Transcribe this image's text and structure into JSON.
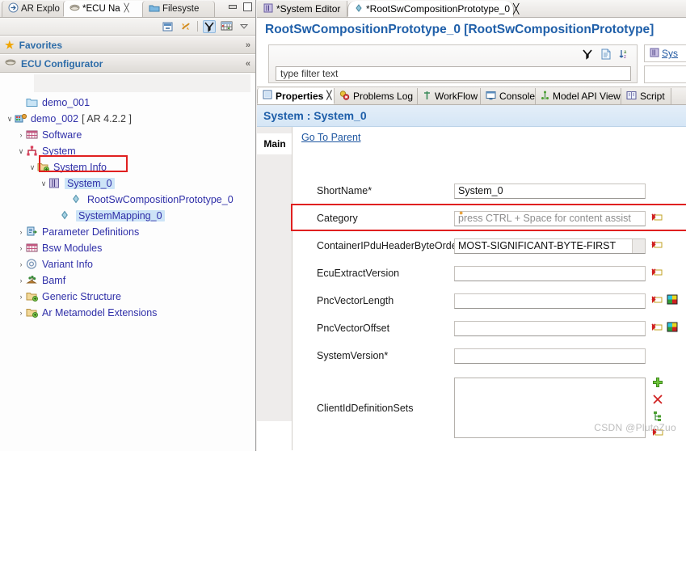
{
  "left_panel": {
    "tabs": [
      {
        "label": "AR Explo",
        "icon": "arrow-right-icon",
        "active": false,
        "closable": false
      },
      {
        "label": "*ECU Na",
        "icon": "ecu-icon",
        "active": true,
        "closable": true
      },
      {
        "label": "Filesyste",
        "icon": "folder-icon",
        "active": false,
        "closable": false
      }
    ],
    "window_controls": [
      "minimize",
      "maximize"
    ],
    "toolbar_icons": [
      "collapse-all-icon",
      "link-with-editor-icon",
      "filter-icon",
      "table-icon",
      "view-menu-icon"
    ],
    "sections": [
      {
        "label": "Favorites",
        "icon": "star-icon",
        "collapse_glyph": "»"
      },
      {
        "label": "ECU Configurator",
        "icon": "ecu-icon",
        "collapse_glyph": "«"
      }
    ],
    "tree": [
      {
        "label": "demo_001",
        "indent": 1,
        "arrow": "",
        "icon": "folder-icon",
        "suffix": ""
      },
      {
        "label": "demo_002",
        "indent": 0,
        "arrow": "∨",
        "icon": "project-icon",
        "suffix": "[ AR 4.2.2 ]"
      },
      {
        "label": "Software",
        "indent": 1,
        "arrow": "›",
        "icon": "software-icon",
        "suffix": ""
      },
      {
        "label": "System",
        "indent": 1,
        "arrow": "∨",
        "icon": "system-icon",
        "suffix": ""
      },
      {
        "label": "System Info",
        "indent": 2,
        "arrow": "∨",
        "icon": "sysinfo-icon",
        "suffix": ""
      },
      {
        "label": "System_0",
        "indent": 3,
        "arrow": "∨",
        "icon": "system0-icon",
        "suffix": "",
        "selected": true,
        "highlighted": true
      },
      {
        "label": "RootSwCompositionPrototype_0",
        "indent": 5,
        "arrow": "",
        "icon": "diamond-icon",
        "suffix": ""
      },
      {
        "label": "SystemMapping_0",
        "indent": 4,
        "arrow": "",
        "icon": "diamond-icon",
        "suffix": "",
        "selected": true
      },
      {
        "label": "Parameter Definitions",
        "indent": 1,
        "arrow": "›",
        "icon": "params-icon",
        "suffix": ""
      },
      {
        "label": "Bsw Modules",
        "indent": 1,
        "arrow": "›",
        "icon": "bsw-icon",
        "suffix": ""
      },
      {
        "label": "Variant Info",
        "indent": 1,
        "arrow": "›",
        "icon": "variant-icon",
        "suffix": ""
      },
      {
        "label": "Bamf",
        "indent": 1,
        "arrow": "›",
        "icon": "bamf-icon",
        "suffix": ""
      },
      {
        "label": "Generic Structure",
        "indent": 1,
        "arrow": "›",
        "icon": "sysinfo-icon",
        "suffix": ""
      },
      {
        "label": "Ar Metamodel Extensions",
        "indent": 1,
        "arrow": "›",
        "icon": "sysinfo-icon",
        "suffix": ""
      }
    ]
  },
  "editor": {
    "tabs": [
      {
        "label": "*System Editor",
        "icon": "system-editor-icon",
        "active": false,
        "closable": false
      },
      {
        "label": "*RootSwCompositionPrototype_0",
        "icon": "diamond-icon",
        "active": true,
        "closable": true
      }
    ],
    "title": "RootSwCompositionPrototype_0 [RootSwCompositionPrototype]",
    "filter": {
      "placeholder": "type filter text",
      "value": "",
      "toolbar_icons": [
        "filter-icon",
        "document-icon",
        "sort-az-icon"
      ]
    },
    "side_box": {
      "label": "Sys",
      "icon": "system-editor-icon"
    }
  },
  "properties": {
    "tabs": [
      {
        "label": "Properties",
        "icon": "properties-icon",
        "active": true,
        "closable": true
      },
      {
        "label": "Problems Log",
        "icon": "problems-icon",
        "active": false,
        "closable": false
      },
      {
        "label": "WorkFlow",
        "icon": "workflow-icon",
        "active": false,
        "closable": false
      },
      {
        "label": "Console",
        "icon": "console-icon",
        "active": false,
        "closable": false
      },
      {
        "label": "Model API View",
        "icon": "model-api-icon",
        "active": false,
        "closable": false
      },
      {
        "label": "Script",
        "icon": "script-icon",
        "active": false,
        "closable": false
      }
    ],
    "section_title": "System : System_0",
    "vertical_tab": "Main",
    "go_to_parent": "Go To Parent",
    "fields": [
      {
        "label": "ShortName*",
        "value": "System_0",
        "placeholder": "",
        "type": "text",
        "icons": [],
        "bulb": false
      },
      {
        "label": "Category",
        "value": "",
        "placeholder": "press CTRL + Space for content assist",
        "type": "text",
        "icons": [
          "red-tag-icon"
        ],
        "bulb": true,
        "highlighted": true
      },
      {
        "label": "ContainerIPduHeaderByteOrder",
        "value": "MOST-SIGNIFICANT-BYTE-FIRST",
        "placeholder": "",
        "type": "combo",
        "icons": [
          "red-tag-icon"
        ],
        "bulb": false
      },
      {
        "label": "EcuExtractVersion",
        "value": "",
        "placeholder": "",
        "type": "text",
        "icons": [
          "red-tag-icon"
        ],
        "bulb": false
      },
      {
        "label": "PncVectorLength",
        "value": "",
        "placeholder": "",
        "type": "text",
        "icons": [
          "red-tag-icon",
          "variant-color-icon"
        ],
        "bulb": false
      },
      {
        "label": "PncVectorOffset",
        "value": "",
        "placeholder": "",
        "type": "text",
        "icons": [
          "red-tag-icon",
          "variant-color-icon"
        ],
        "bulb": false
      },
      {
        "label": "SystemVersion*",
        "value": "",
        "placeholder": "",
        "type": "text",
        "icons": [],
        "bulb": false
      }
    ],
    "list_field": {
      "label": "ClientIdDefinitionSets",
      "value": "",
      "buttons": [
        "add-icon",
        "delete-icon",
        "move-icon",
        "red-tag-icon"
      ]
    }
  },
  "watermark": "CSDN @PlutoZuo",
  "colors": {
    "link": "#1e56a0",
    "title": "#1f5fa9",
    "tree_text": "#2f2fa8",
    "highlight_border": "#e02020",
    "selection": "#cde4f7"
  }
}
